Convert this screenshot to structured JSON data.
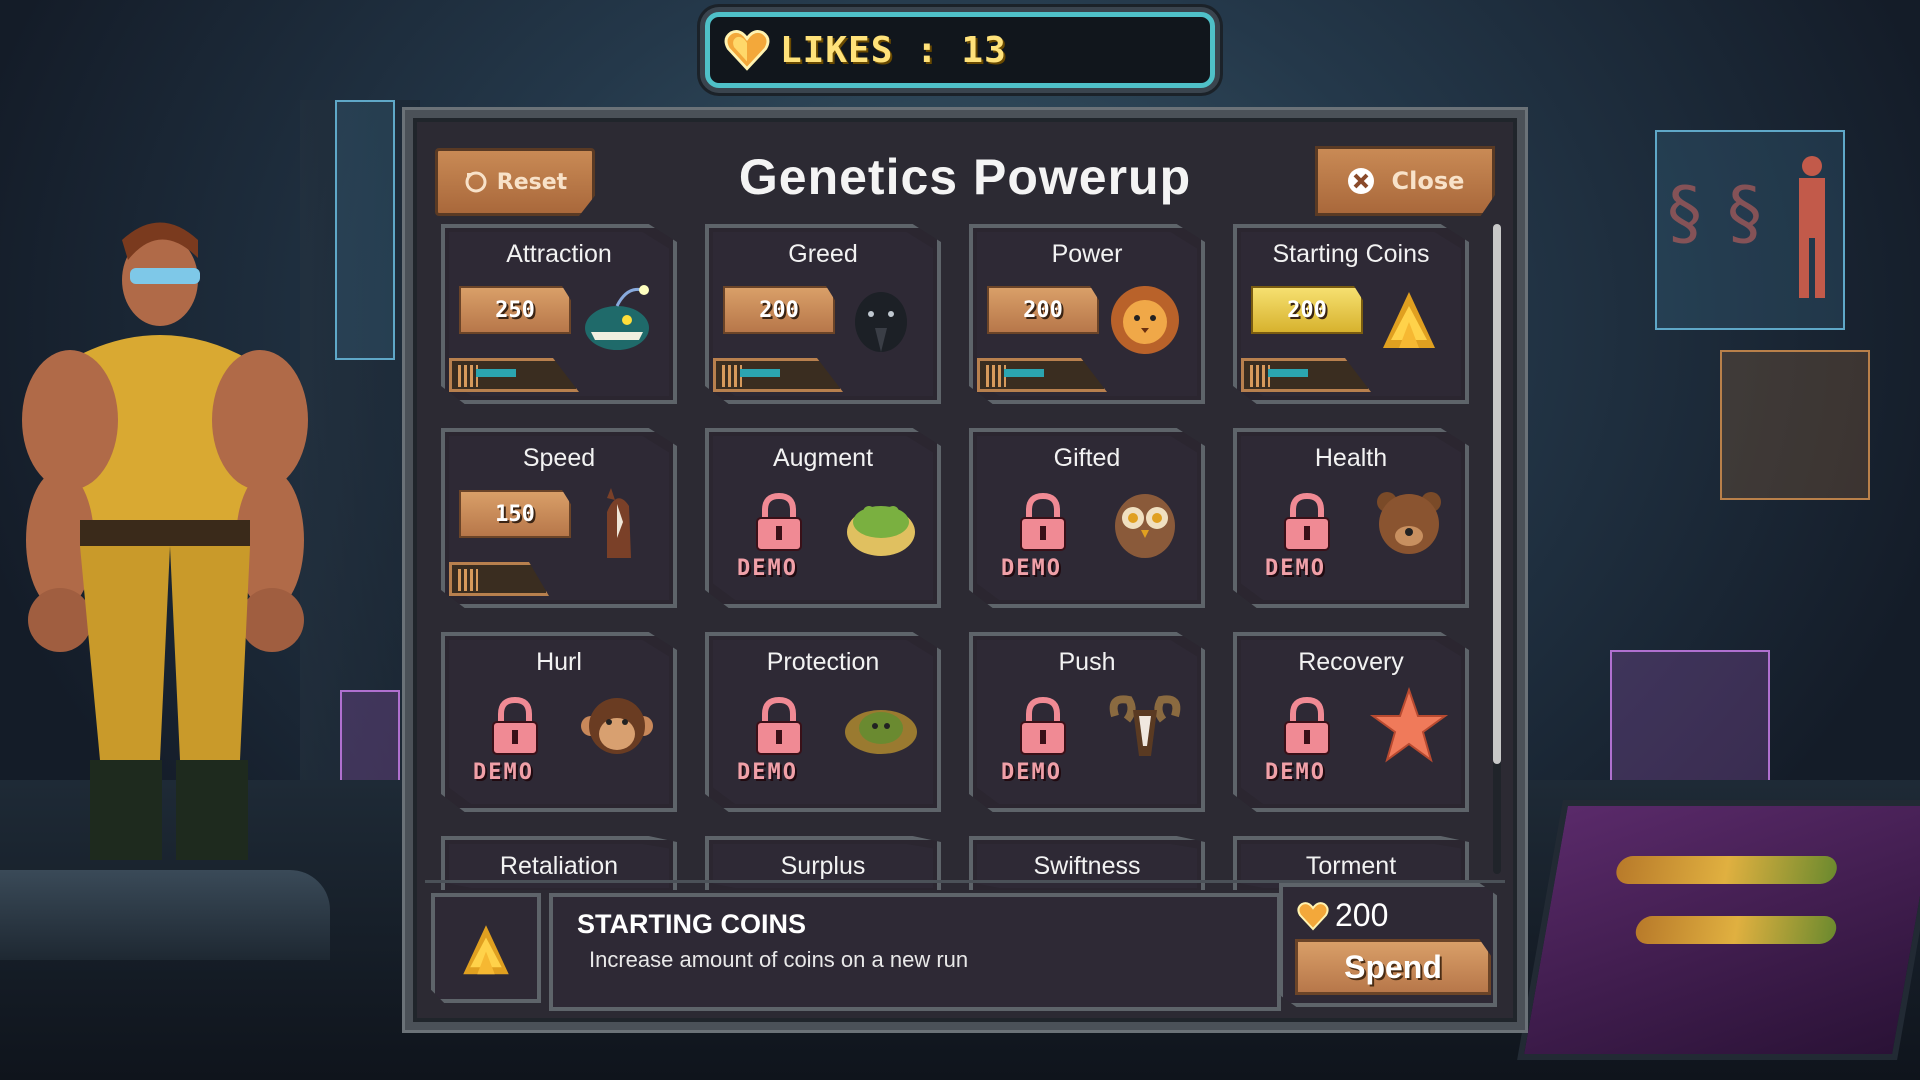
{
  "likes": {
    "label": "LIKES : 13"
  },
  "header": {
    "title": "Genetics Powerup",
    "reset_label": "Reset",
    "close_label": "Close"
  },
  "powerups": [
    {
      "name": "Attraction",
      "cost": "250",
      "locked": false,
      "icon": "anglerfish-icon"
    },
    {
      "name": "Greed",
      "cost": "200",
      "locked": false,
      "icon": "raven-icon"
    },
    {
      "name": "Power",
      "cost": "200",
      "locked": false,
      "icon": "lion-icon"
    },
    {
      "name": "Starting Coins",
      "cost": "200",
      "locked": false,
      "icon": "coin-pile-icon",
      "selected": true
    },
    {
      "name": "Speed",
      "cost": "150",
      "locked": false,
      "icon": "horse-icon"
    },
    {
      "name": "Augment",
      "badge": "DEMO",
      "locked": true,
      "icon": "frog-icon"
    },
    {
      "name": "Gifted",
      "badge": "DEMO",
      "locked": true,
      "icon": "owl-icon"
    },
    {
      "name": "Health",
      "badge": "DEMO",
      "locked": true,
      "icon": "bear-icon"
    },
    {
      "name": "Hurl",
      "badge": "DEMO",
      "locked": true,
      "icon": "monkey-icon"
    },
    {
      "name": "Protection",
      "badge": "DEMO",
      "locked": true,
      "icon": "turtle-icon"
    },
    {
      "name": "Push",
      "badge": "DEMO",
      "locked": true,
      "icon": "ram-icon"
    },
    {
      "name": "Recovery",
      "badge": "DEMO",
      "locked": true,
      "icon": "starfish-icon"
    },
    {
      "name": "Retaliation"
    },
    {
      "name": "Surplus"
    },
    {
      "name": "Swiftness"
    },
    {
      "name": "Torment"
    }
  ],
  "details": {
    "title": "STARTING COINS",
    "description": "Increase amount of coins on a new run",
    "price": "200",
    "spend_label": "Spend",
    "icon": "coin-pile-icon"
  },
  "colors": {
    "accent_teal": "#4fc0c8",
    "button_brown": "#c98a55",
    "likes_text": "#ffe27a",
    "demo_pink": "#f0a0a8"
  }
}
